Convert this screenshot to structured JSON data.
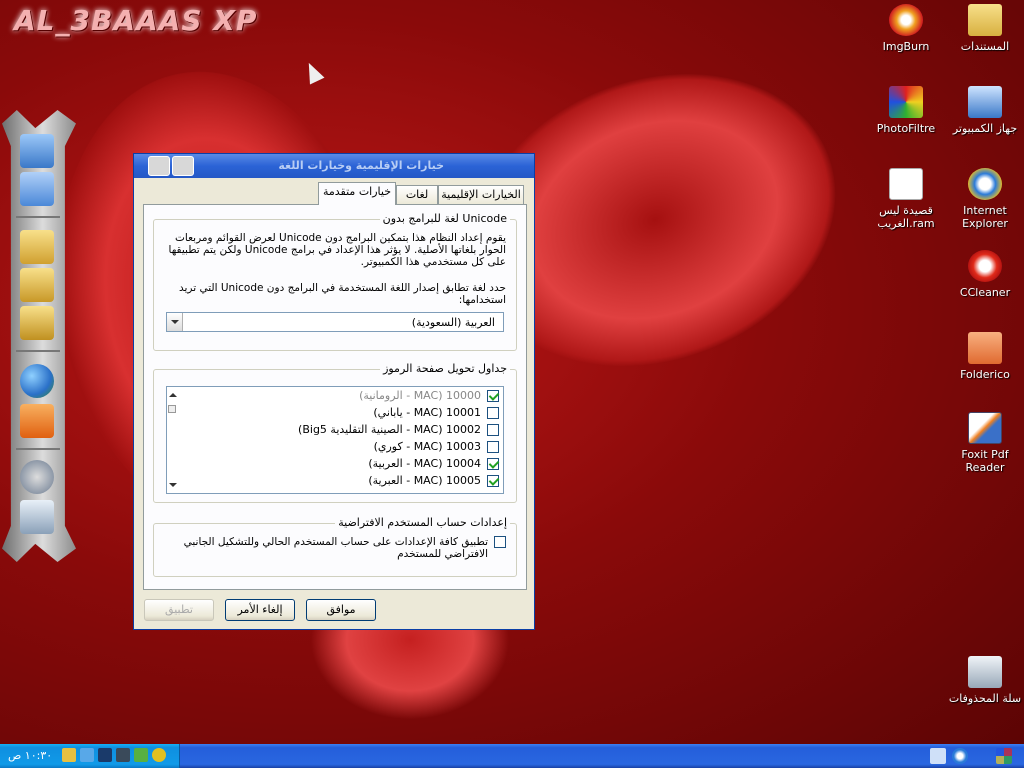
{
  "desktop": {
    "watermark": "AL_3BAAAS XP",
    "icons": [
      {
        "label": "ImgBurn",
        "icon": "imgburn-icon"
      },
      {
        "label": "المستندات",
        "icon": "documents-folder-icon"
      },
      {
        "label": "PhotoFiltre",
        "icon": "photofiltre-icon"
      },
      {
        "label": "جهاز الكمبيوتر",
        "icon": "my-computer-icon"
      },
      {
        "label": "قصيدة ليس الغريب.ram",
        "icon": "ram-file-icon"
      },
      {
        "label": "Internet Explorer",
        "icon": "ie-icon"
      },
      {
        "label": "CCleaner",
        "icon": "ccleaner-icon"
      },
      {
        "label": "Folderico",
        "icon": "folderico-icon"
      },
      {
        "label": "Foxit Pdf Reader",
        "icon": "foxit-icon"
      },
      {
        "label": "سلة المحذوفات",
        "icon": "recycle-bin-icon"
      }
    ]
  },
  "dialog": {
    "title": "خيارات الإقليمية وخيارات اللغة",
    "tabs": [
      {
        "label": "الخيارات الإقليمية",
        "active": false
      },
      {
        "label": "لغات",
        "active": false
      },
      {
        "label": "خيارات متقدمة",
        "active": true
      }
    ],
    "unicode_group": {
      "title": "لغة للبرامج بدون Unicode",
      "description": "يقوم إعداد النظام هذا بتمكين البرامج دون Unicode لعرض القوائم ومربعات الحوار بلغاتها الأصلية. لا يؤثر هذا الإعداد في برامج Unicode ولكن يتم تطبيقها على كل مستخدمي هذا الكمبيوتر.",
      "prompt": "حدد لغة تطابق إصدار اللغة المستخدمة في البرامج دون Unicode التي تريد استخدامها:",
      "selected_language": "العربية (السعودية)"
    },
    "codepage_group": {
      "title": "جداول تحويل صفحة الرموز",
      "items": [
        {
          "label": "10000 (MAC - الرومانية)",
          "checked": true,
          "dim": true
        },
        {
          "label": "10001 (MAC - ياباني)",
          "checked": false,
          "dim": false
        },
        {
          "label": "10002 (MAC - الصينية التقليدية Big5)",
          "checked": false,
          "dim": false
        },
        {
          "label": "10003 (MAC - كوري)",
          "checked": false,
          "dim": false
        },
        {
          "label": "10004 (MAC - العربية)",
          "checked": true,
          "dim": false
        },
        {
          "label": "10005 (MAC - العبرية)",
          "checked": true,
          "dim": false
        }
      ]
    },
    "default_user_group": {
      "title": "إعدادات حساب المستخدم الافتراضية",
      "checkbox_label": "تطبيق كافة الإعدادات على حساب المستخدم الحالي وللتشكيل الجانبي الافتراضي للمستخدم",
      "checked": false
    },
    "buttons": {
      "ok": "موافق",
      "cancel": "إلغاء الأمر",
      "apply": "تطبيق"
    }
  },
  "taskbar": {
    "clock": "١٠:٣٠ ص"
  },
  "colors": {
    "desktop_red": "#8a0a0a",
    "titlebar_blue": "#2b63d6",
    "dialog_bg": "#ece9d8",
    "taskbar_blue": "#245edb",
    "tray_blue": "#0f8fe0"
  }
}
